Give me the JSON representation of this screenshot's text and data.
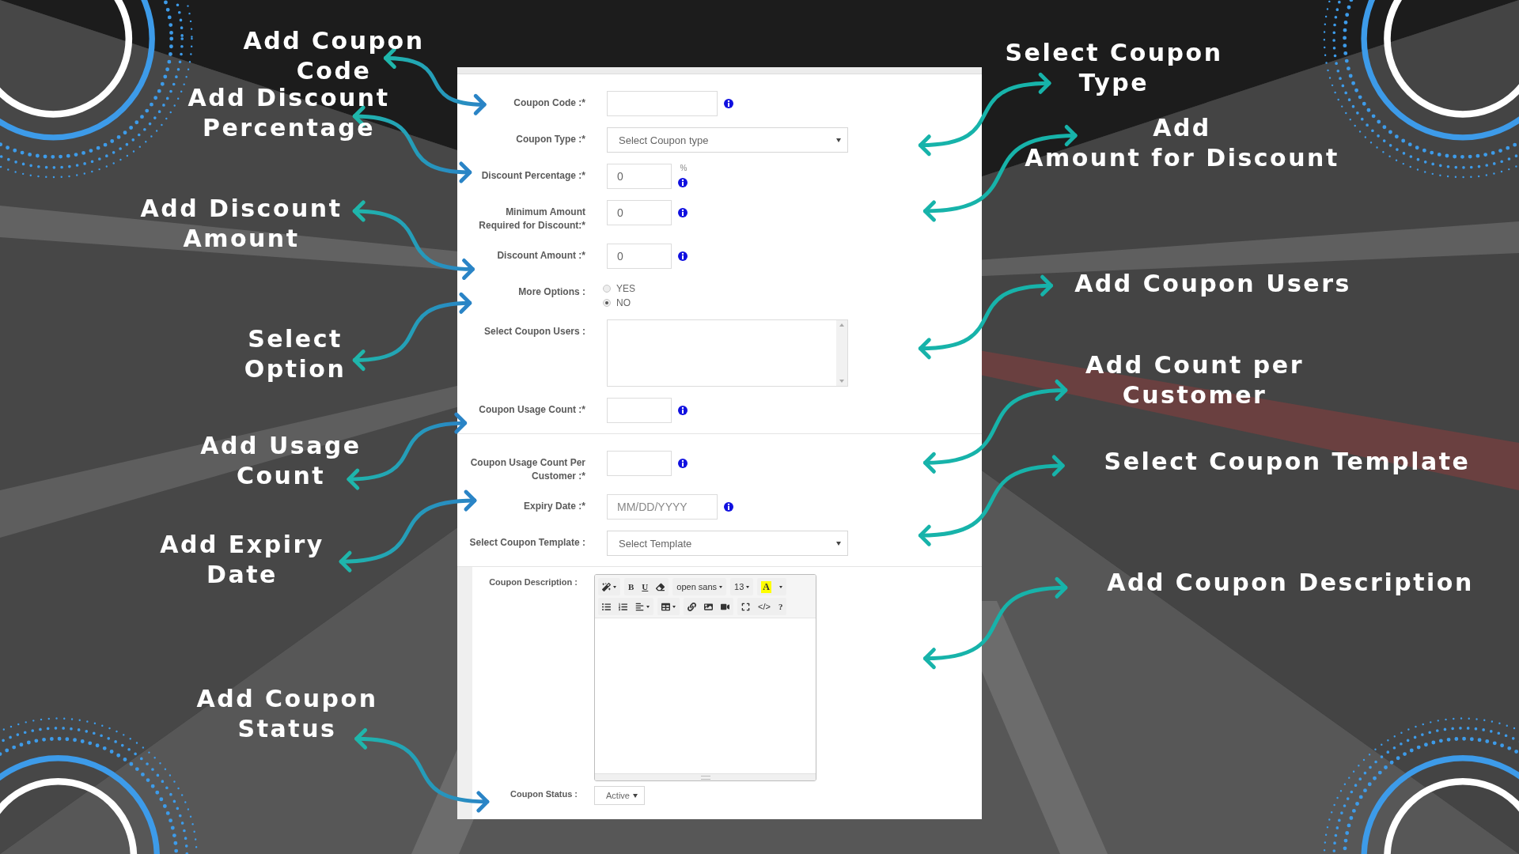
{
  "form": {
    "sections": [
      {
        "fields": [
          {
            "kind": "text",
            "label": "Coupon Code :*",
            "info": true
          },
          {
            "kind": "select",
            "label": "Coupon Type :*",
            "value": "Select Coupon type"
          },
          {
            "kind": "number",
            "label": "Discount Percentage :*",
            "value": "0",
            "unit": "%",
            "info": true
          },
          {
            "kind": "number",
            "label": "Minimum Amount Required for Discount:*",
            "value": "0",
            "info": true
          },
          {
            "kind": "number",
            "label": "Discount Amount :*",
            "value": "0",
            "info": true
          },
          {
            "kind": "radio",
            "label": "More Options :",
            "options": [
              {
                "label": "YES",
                "selected": false
              },
              {
                "label": "NO",
                "selected": true
              }
            ]
          },
          {
            "kind": "listbox",
            "label": "Select Coupon Users :"
          },
          {
            "kind": "number",
            "label": "Coupon Usage Count :*",
            "info": true
          }
        ]
      },
      {
        "fields": [
          {
            "kind": "number",
            "label": "Coupon Usage Count Per Customer :*",
            "info": true
          },
          {
            "kind": "date",
            "label": "Expiry Date :*",
            "placeholder": "MM/DD/YYYY",
            "info": true
          },
          {
            "kind": "select",
            "label": "Select Coupon Template :",
            "value": "Select Template"
          }
        ]
      }
    ]
  },
  "description": {
    "label": "Coupon Description :",
    "toolbar": {
      "bold": "B",
      "underline": "U",
      "font": "open sans",
      "size": "13",
      "highlight": "A",
      "code": "</>",
      "help": "?"
    }
  },
  "status": {
    "label": "Coupon Status :",
    "value": "Active"
  },
  "callouts": {
    "left": [
      "Add Coupon\nCode",
      "Add Discount\nPercentage",
      "Add Discount\nAmount",
      "Select\nOption",
      "Add Usage\nCount",
      "Add Expiry\nDate",
      "Add Coupon\nStatus"
    ],
    "right": [
      "Select Coupon\nType",
      "Add\nAmount for Discount",
      "Add Coupon Users",
      "Add Count per\nCustomer",
      "Select Coupon Template",
      "Add Coupon Description"
    ]
  }
}
